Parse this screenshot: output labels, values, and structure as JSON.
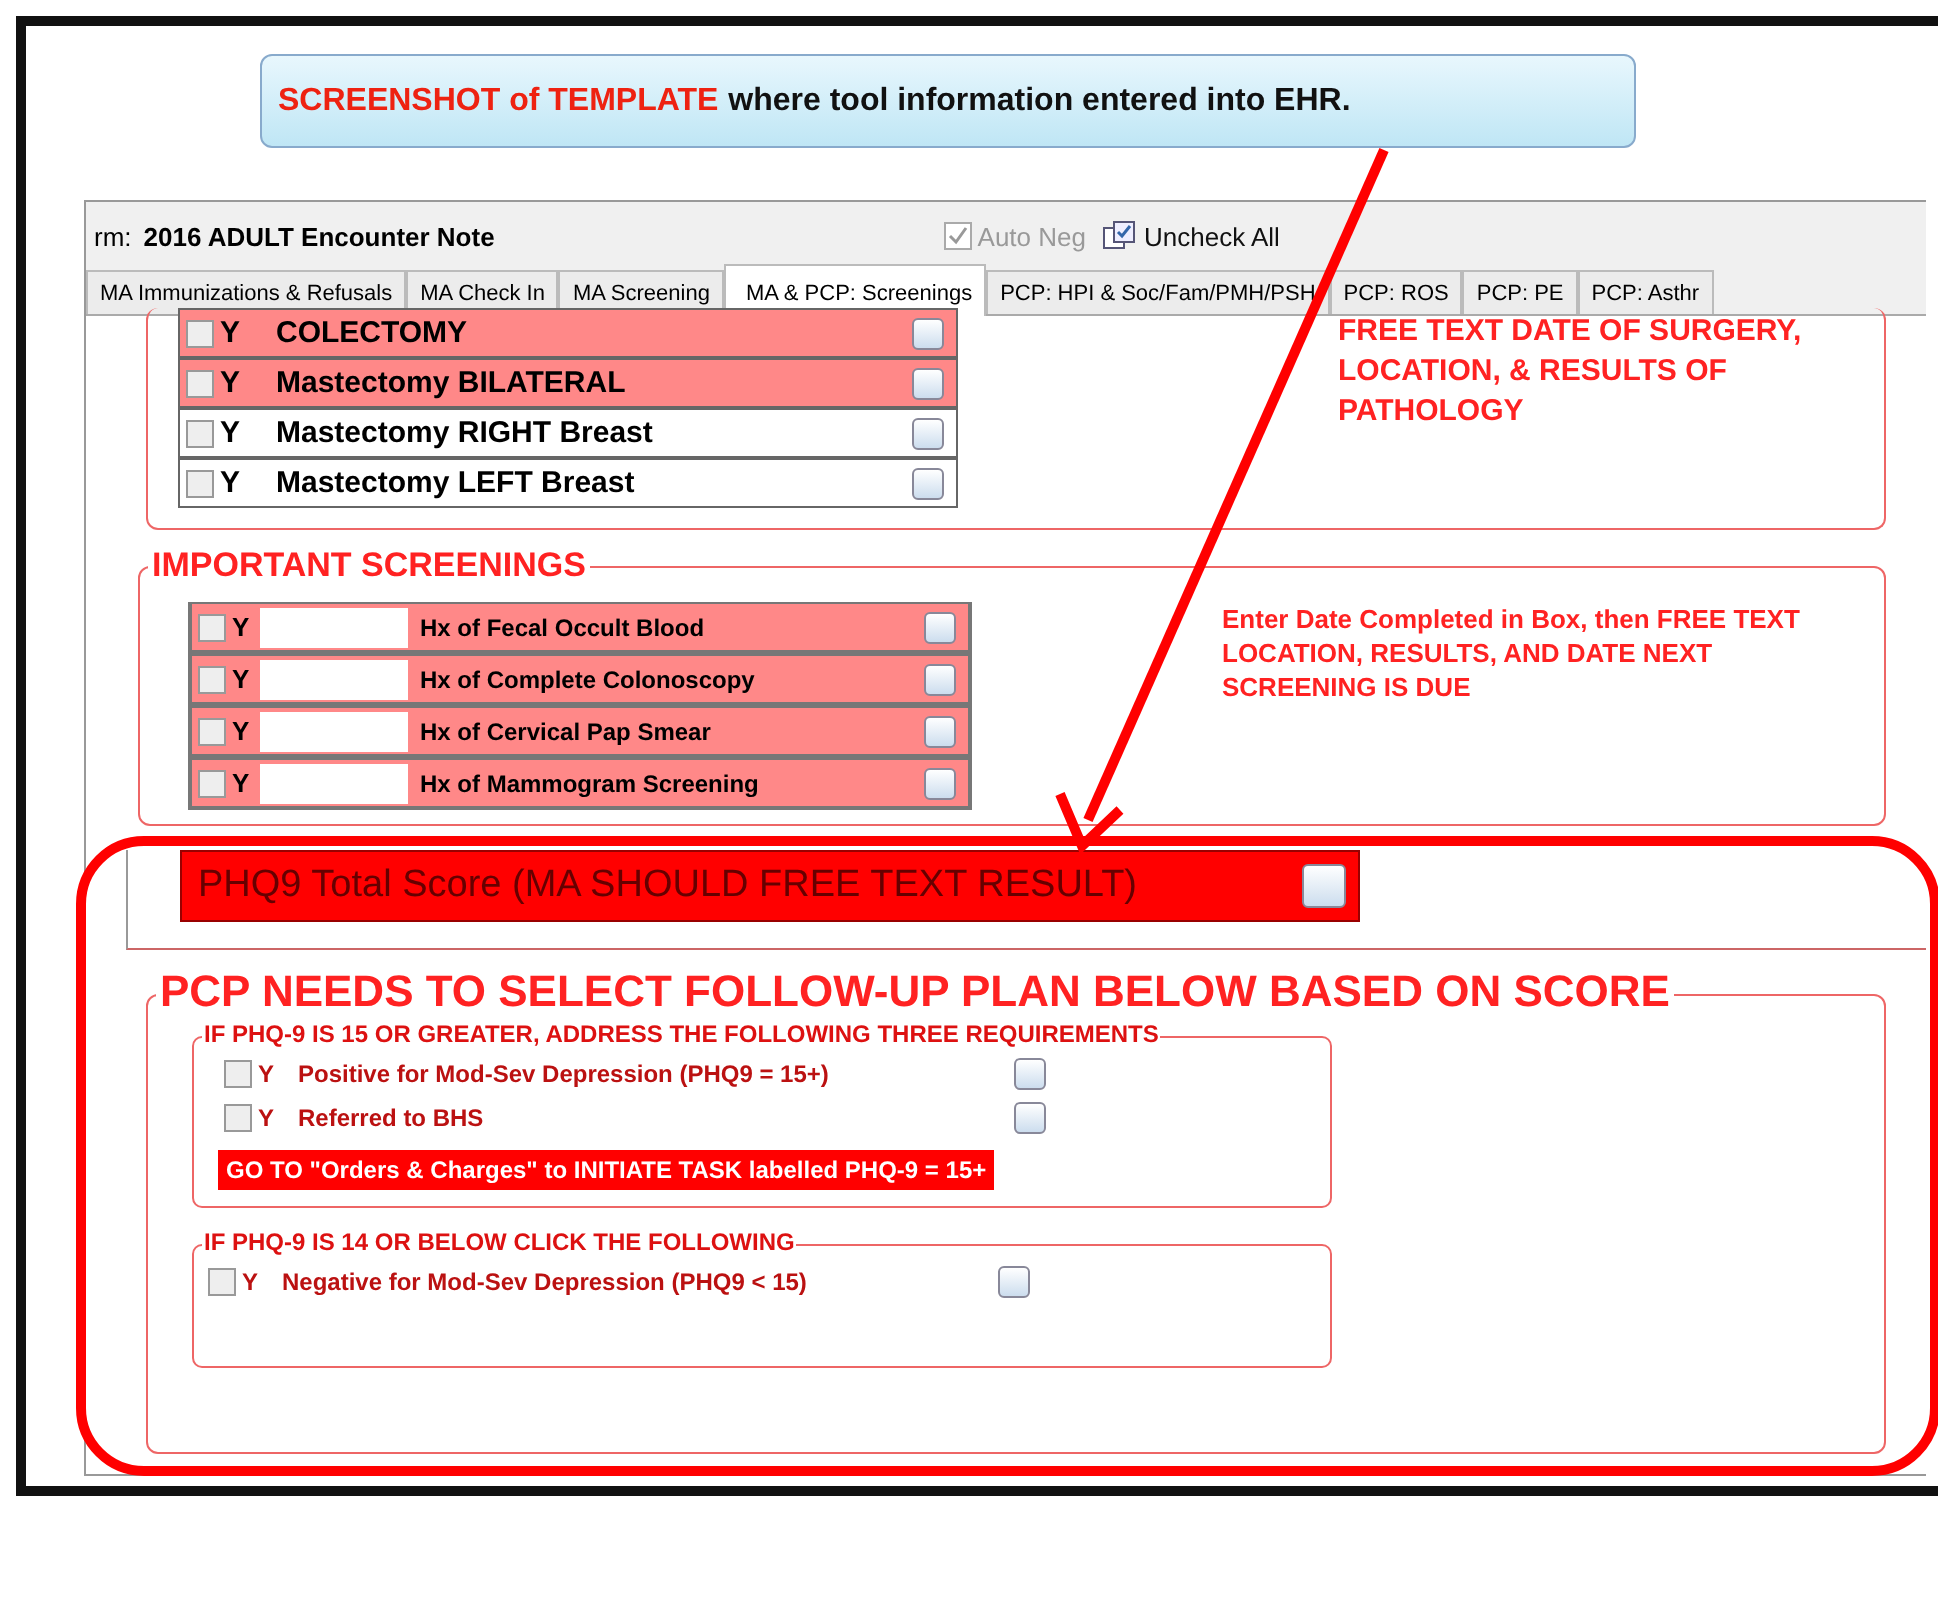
{
  "callout": {
    "highlight": "SCREENSHOT of TEMPLATE",
    "text": "where tool information entered into EHR."
  },
  "form": {
    "label": "rm:",
    "title": "2016 ADULT Encounter Note"
  },
  "toolbar": [
    {
      "kind": "checkbox",
      "label": "Auto Neg",
      "checked": true,
      "disabled": true
    },
    {
      "kind": "button",
      "label": "Uncheck All",
      "disabled": false
    }
  ],
  "tabs": [
    {
      "label": "MA Immunizations & Refusals",
      "selected": false
    },
    {
      "label": "MA Check In",
      "selected": false
    },
    {
      "label": "MA Screening",
      "selected": false
    },
    {
      "label": "MA & PCP: Screenings",
      "selected": true
    },
    {
      "label": "PCP: HPI & Soc/Fam/PMH/PSH",
      "selected": false
    },
    {
      "label": "PCP: ROS",
      "selected": false
    },
    {
      "label": "PCP: PE",
      "selected": false
    },
    {
      "label": "PCP: Asthr",
      "selected": false
    }
  ],
  "surgeries": {
    "rows": [
      {
        "mark": "Y",
        "label": "COLECTOMY",
        "checked": false,
        "highlighted": true
      },
      {
        "mark": "Y",
        "label": "Mastectomy BILATERAL",
        "checked": false,
        "highlighted": true
      },
      {
        "mark": "Y",
        "label": "Mastectomy RIGHT Breast",
        "checked": false,
        "highlighted": false
      },
      {
        "mark": "Y",
        "label": "Mastectomy LEFT Breast",
        "checked": false,
        "highlighted": false
      }
    ],
    "note": "FREE TEXT DATE OF SURGERY, LOCATION, & RESULTS OF PATHOLOGY"
  },
  "screenings": {
    "title": "IMPORTANT SCREENINGS",
    "rows": [
      {
        "mark": "Y",
        "label": "Hx of Fecal Occult Blood",
        "checked": false
      },
      {
        "mark": "Y",
        "label": "Hx of Complete Colonoscopy",
        "checked": false
      },
      {
        "mark": "Y",
        "label": "Hx of Cervical Pap Smear",
        "checked": false
      },
      {
        "mark": "Y",
        "label": "Hx of Mammogram Screening",
        "checked": false
      }
    ],
    "note": "Enter Date Completed in Box, then FREE TEXT LOCATION, RESULTS, AND DATE NEXT SCREENING IS DUE"
  },
  "phq9": {
    "label": "PHQ9 Total Score (MA SHOULD FREE TEXT RESULT)"
  },
  "followup": {
    "title": "PCP NEEDS TO SELECT FOLLOW-UP PLAN BELOW BASED ON SCORE",
    "groups": [
      {
        "title": "IF PHQ-9 IS 15 OR GREATER, ADDRESS THE FOLLOWING THREE REQUIREMENTS",
        "items": [
          {
            "kind": "check",
            "mark": "Y",
            "label": "Positive for Mod-Sev Depression (PHQ9 = 15+)",
            "checked": false
          },
          {
            "kind": "check",
            "mark": "Y",
            "label": "Referred to BHS",
            "checked": false
          },
          {
            "kind": "alert",
            "label": "GO TO \"Orders & Charges\" to INITIATE TASK labelled PHQ-9 = 15+"
          }
        ]
      },
      {
        "title": "IF PHQ-9 IS 14 OR BELOW CLICK THE FOLLOWING",
        "items": [
          {
            "kind": "check",
            "mark": "Y",
            "label": "Negative for Mod-Sev Depression (PHQ9 < 15)",
            "checked": false
          }
        ]
      }
    ]
  }
}
